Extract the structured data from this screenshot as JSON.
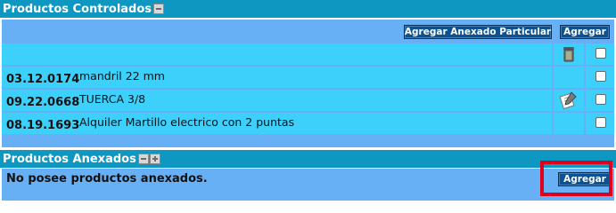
{
  "controlled": {
    "title": "Productos Controlados",
    "add_attached_particular_label": "Agregar Anexado Particular",
    "add_label": "Agregar",
    "items": [
      {
        "code": "03.12.0174",
        "description": "mandril 22 mm",
        "icon": "none"
      },
      {
        "code": "09.22.0668",
        "description": "TUERCA 3/8",
        "icon": "edit-pencil-icon"
      },
      {
        "code": "08.19.1693",
        "description": "Alquiler Martillo electrico con 2 puntas",
        "icon": "none"
      }
    ]
  },
  "attached": {
    "title": "Productos Anexados",
    "empty_message": "No posee productos anexados.",
    "add_label": "Agregar"
  },
  "colors": {
    "header": "#0e97c0",
    "panel": "#68b0f6",
    "row": "#3dd0fb",
    "button": "#0d5290",
    "highlight": "#e0001b"
  }
}
